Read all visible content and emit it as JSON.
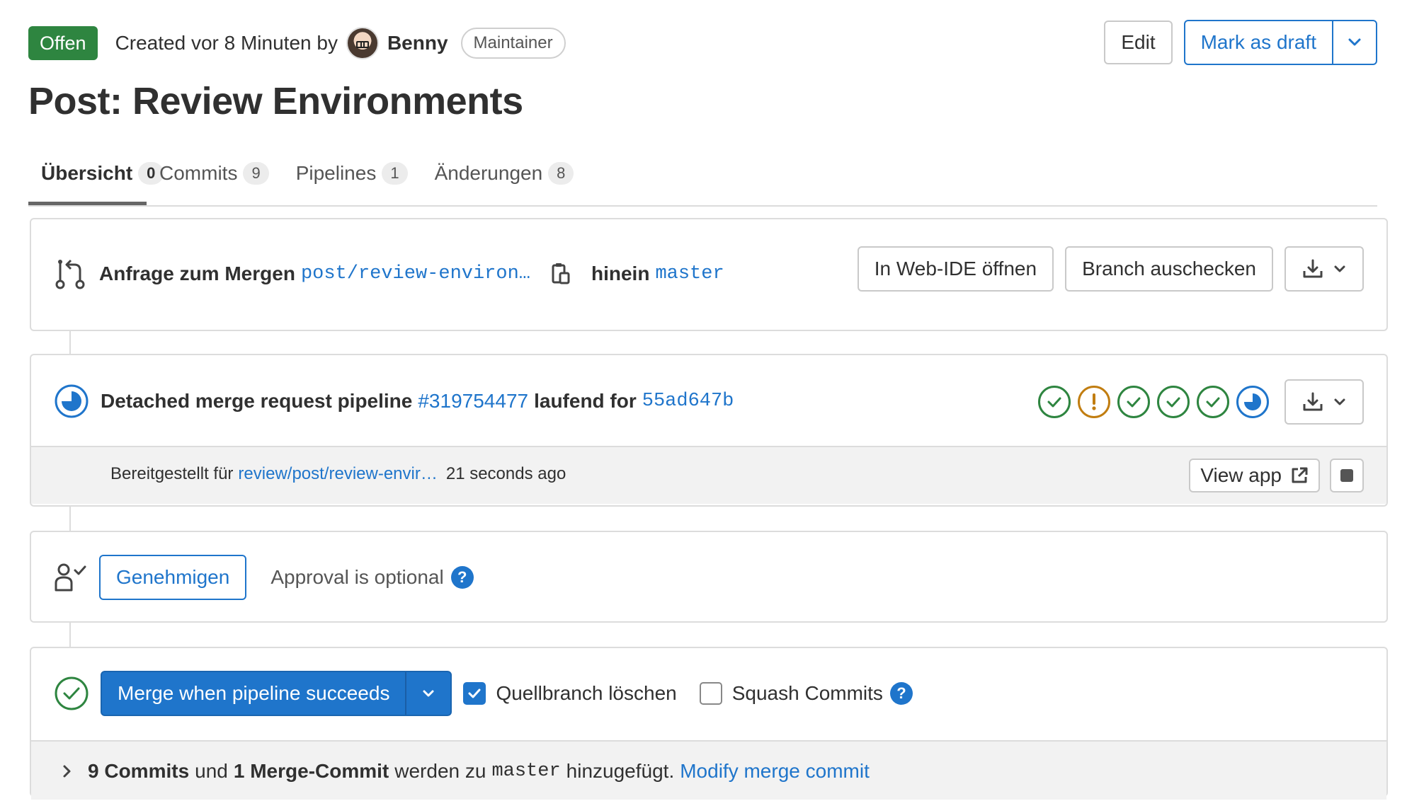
{
  "header": {
    "status": "Offen",
    "created_prefix": "Created vor 8 Minuten by",
    "author": "Benny",
    "role": "Maintainer",
    "edit_label": "Edit",
    "draft_label": "Mark as draft"
  },
  "title": "Post: Review Environments",
  "tabs": [
    {
      "label": "Übersicht",
      "count": "0"
    },
    {
      "label": "Commits",
      "count": "9"
    },
    {
      "label": "Pipelines",
      "count": "1"
    },
    {
      "label": "Änderungen",
      "count": "8"
    }
  ],
  "merge_info": {
    "prefix": "Anfrage zum Mergen",
    "source_branch": "post/review-environ…",
    "into": "hinein",
    "target_branch": "master",
    "webide_label": "In Web-IDE öffnen",
    "checkout_label": "Branch auschecken"
  },
  "pipeline": {
    "prefix": "Detached merge request pipeline",
    "id": "#319754477",
    "status": "laufend for",
    "commit": "55ad647b",
    "stages": [
      "success",
      "warning",
      "success",
      "success",
      "success",
      "running"
    ]
  },
  "deployment": {
    "prefix": "Bereitgestellt für",
    "env": "review/post/review-envir…",
    "time": "21 seconds ago",
    "view_app_label": "View app"
  },
  "approval": {
    "button_label": "Genehmigen",
    "text": "Approval is optional"
  },
  "merge": {
    "button_label": "Merge when pipeline succeeds",
    "delete_branch_label": "Quellbranch löschen",
    "delete_branch_checked": true,
    "squash_label": "Squash Commits",
    "squash_checked": false,
    "commits_count": "9 Commits",
    "und": "und",
    "merge_commit": "1 Merge-Commit",
    "werden_zu": "werden zu",
    "target": "master",
    "hinzugefuegt": "hinzugefügt.",
    "modify_label": "Modify merge commit"
  }
}
